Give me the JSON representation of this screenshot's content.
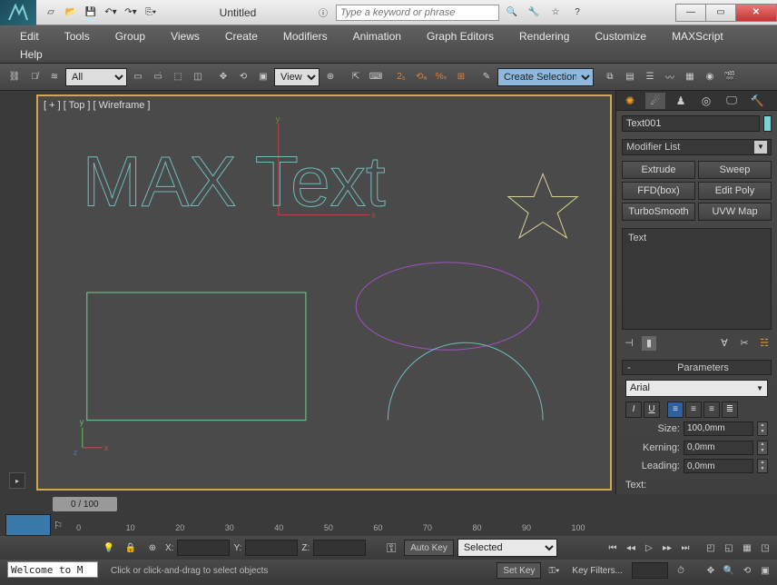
{
  "window": {
    "title": "Untitled",
    "search_placeholder": "Type a keyword or phrase"
  },
  "menu": [
    "Edit",
    "Tools",
    "Group",
    "Views",
    "Create",
    "Modifiers",
    "Animation",
    "Graph Editors",
    "Rendering",
    "Customize",
    "MAXScript",
    "Help"
  ],
  "toolbar": {
    "filter_all": "All",
    "ref_view": "View",
    "selection_set": "Create Selection Se"
  },
  "viewport": {
    "label": "[ + ] [ Top ] [ Wireframe ]",
    "text_object": "MAX Text"
  },
  "panel": {
    "object_name": "Text001",
    "modifier_list": "Modifier List",
    "modifiers": [
      "Extrude",
      "Sweep",
      "FFD(box)",
      "Edit Poly",
      "TurboSmooth",
      "UVW Map"
    ],
    "stack_item": "Text",
    "rollout_title": "Parameters",
    "font": "Arial",
    "style_labels": {
      "italic": "I",
      "underline": "U"
    },
    "size_label": "Size:",
    "size_value": "100,0mm",
    "kerning_label": "Kerning:",
    "kerning_value": "0,0mm",
    "leading_label": "Leading:",
    "leading_value": "0,0mm",
    "text_label": "Text:"
  },
  "time": {
    "slider": "0 / 100",
    "ticks": [
      0,
      10,
      20,
      30,
      40,
      50,
      60,
      70,
      80,
      90,
      100
    ]
  },
  "status": {
    "x": "X:",
    "y": "Y:",
    "z": "Z:",
    "autokey": "Auto Key",
    "setkey": "Set Key",
    "selected": "Selected",
    "keyfilters": "Key Filters...",
    "hint": "Click or click-and-drag to select objects",
    "welcome": "Welcome to M"
  }
}
